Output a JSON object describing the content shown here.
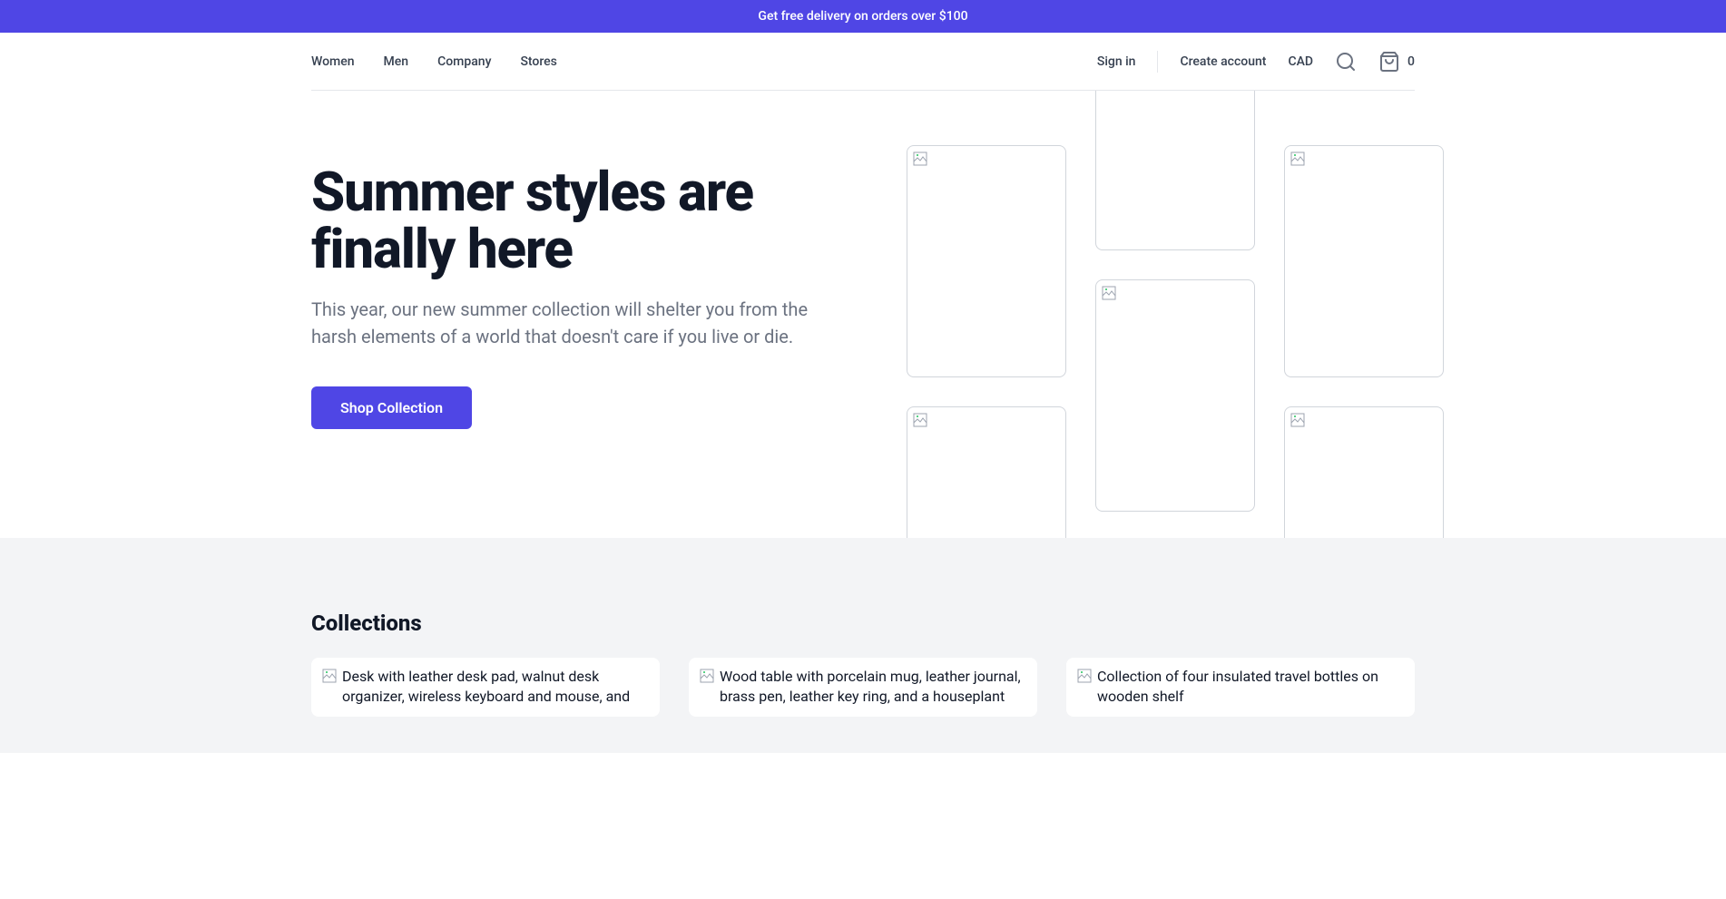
{
  "promo": {
    "text": "Get free delivery on orders over $100"
  },
  "nav": {
    "links": [
      "Women",
      "Men",
      "Company",
      "Stores"
    ],
    "signin": "Sign in",
    "create": "Create account",
    "currency": "CAD",
    "cart_count": "0"
  },
  "hero": {
    "title": "Summer styles are finally here",
    "desc": "This year, our new summer collection will shelter you from the harsh elements of a world that doesn't care if you live or die.",
    "cta": "Shop Collection"
  },
  "collections": {
    "title": "Collections",
    "items": [
      {
        "alt": "Desk with leather desk pad, walnut desk organizer, wireless keyboard and mouse, and"
      },
      {
        "alt": "Wood table with porcelain mug, leather journal, brass pen, leather key ring, and a houseplant"
      },
      {
        "alt": "Collection of four insulated travel bottles on wooden shelf"
      }
    ]
  }
}
